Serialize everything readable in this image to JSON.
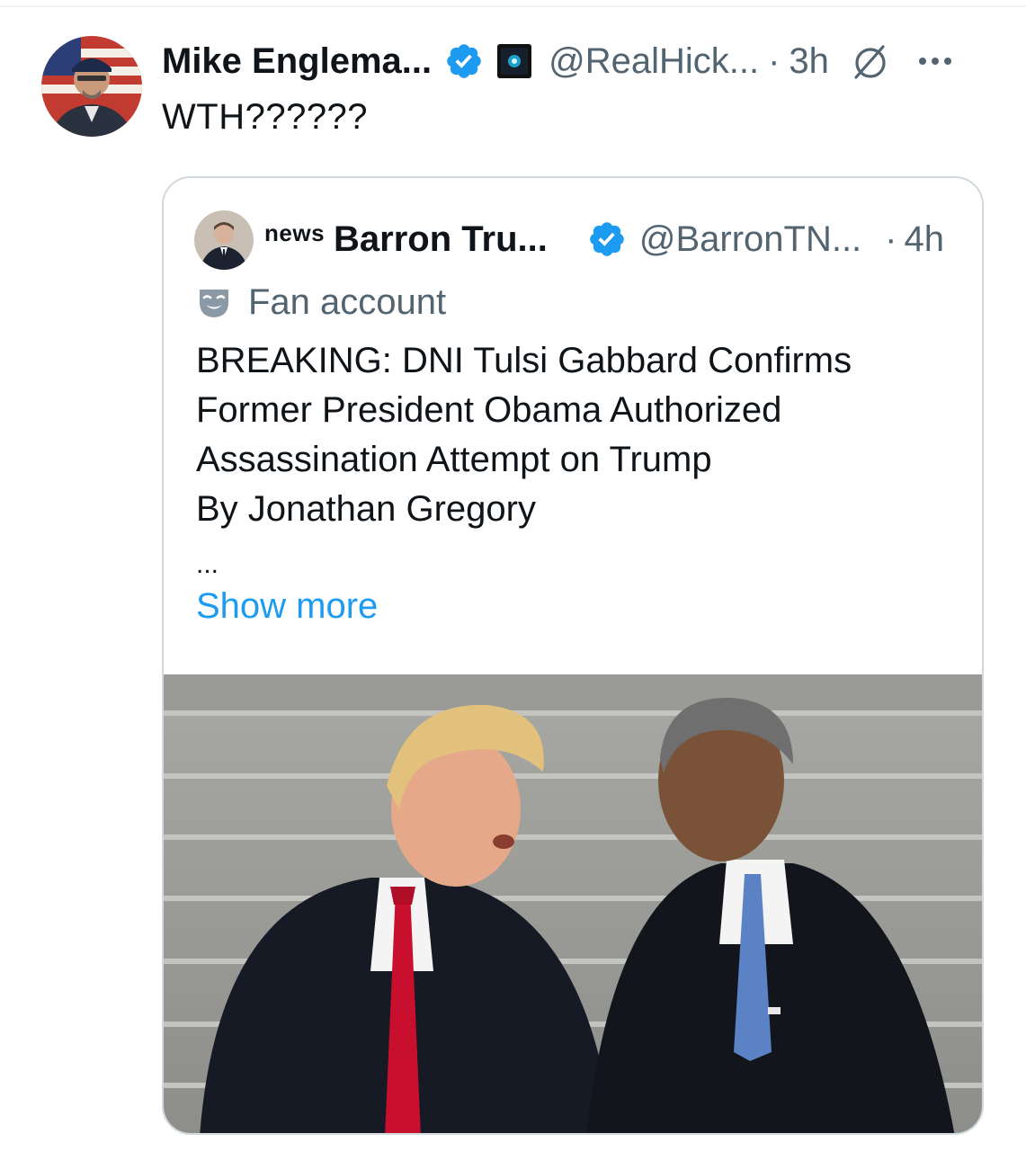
{
  "tweet": {
    "author_name": "Mike Englema...",
    "handle": "@RealHick...",
    "separator": "·",
    "time": "3h",
    "text": "WTH??????"
  },
  "quoted_tweet": {
    "source_label": "news",
    "author_name": "Barron Tru...",
    "handle": "@BarronTN...",
    "separator": "·",
    "time": "4h",
    "account_label": "Fan account",
    "body_lines": [
      "BREAKING: DNI Tulsi Gabbard Confirms",
      "Former President Obama Authorized",
      "Assassination Attempt on Trump",
      "By Jonathan Gregory"
    ],
    "ellipsis": "...",
    "show_more": "Show more"
  },
  "icons": {
    "verified": "verified-badge-icon",
    "affiliate": "affiliate-badge-icon",
    "grok": "grok-icon",
    "more": "more-options-icon",
    "fan": "theater-mask-icon"
  },
  "colors": {
    "text_primary": "#0f1419",
    "text_secondary": "#536471",
    "link": "#1d9bf0",
    "verified": "#1d9bf0",
    "border": "#cfd9de"
  }
}
